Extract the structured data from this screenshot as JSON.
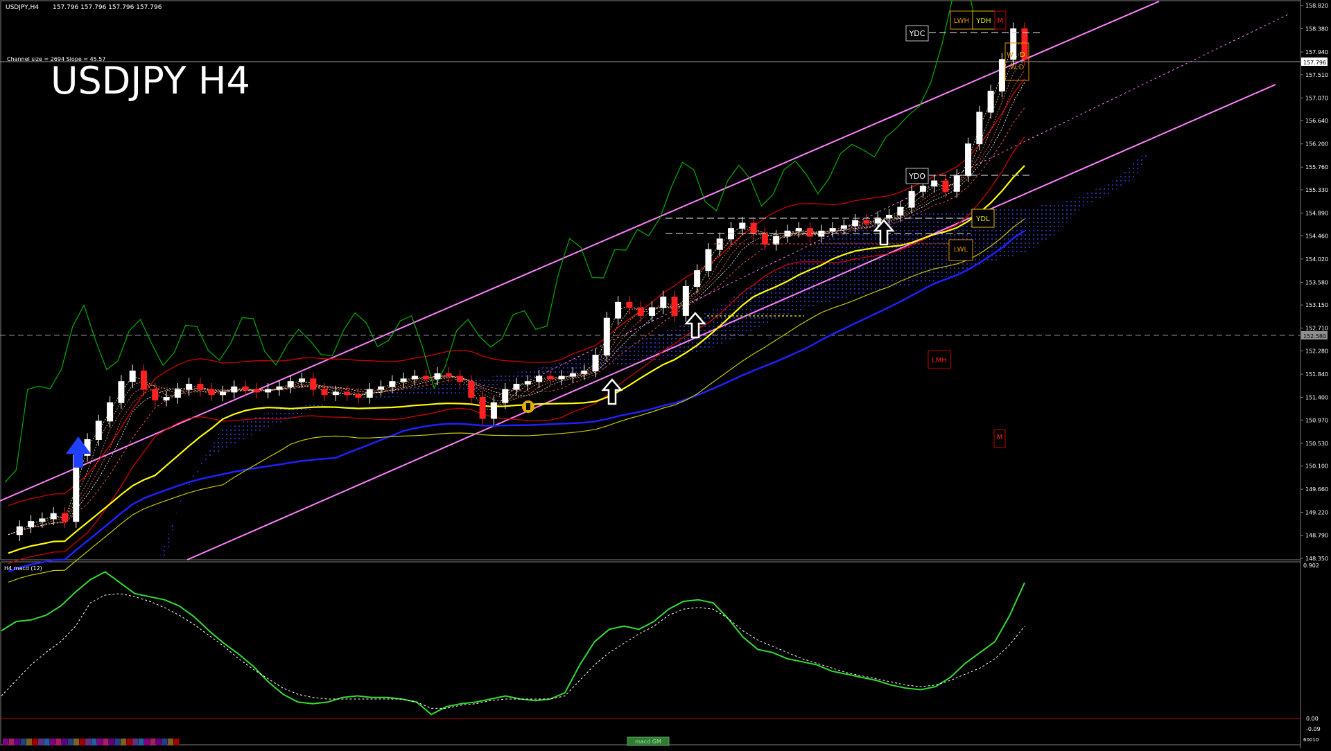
{
  "header": {
    "symbol_info": "USDJPY,H4",
    "ohlc": "157.796 157.796 157.796 157.796",
    "channel_info": "Channel size = 2694 Slope = 45.57",
    "big_title": "USDJPY H4"
  },
  "price_axis": {
    "labels": [
      "158.820",
      "158.380",
      "157.940",
      "157.510",
      "157.070",
      "156.640",
      "156.200",
      "155.760",
      "155.330",
      "154.890",
      "154.460",
      "154.020",
      "153.580",
      "153.150",
      "152.710",
      "152.280",
      "151.840",
      "151.400",
      "150.970",
      "150.530",
      "150.100",
      "149.660",
      "149.220",
      "148.790",
      "148.350"
    ],
    "current_price": "157.796",
    "marker_price": "152.580"
  },
  "level_boxes": {
    "ydc": "YDC",
    "ydo": "YDO",
    "ydl": "YDL",
    "lwh": "LWH",
    "ydh": "YDH",
    "lwl": "LWL",
    "lmh": "LMH",
    "m1": "M",
    "m2": "M",
    "w": "W",
    "d": "D",
    "wd": "W D"
  },
  "macd": {
    "title": "H4  macd (12)",
    "axis_labels": [
      "0.902",
      "0.00",
      "-0.09"
    ],
    "bottom_label": "macd GM",
    "corner_label": "60010"
  },
  "colors": {
    "background": "#000000",
    "channel": "#ff80ff",
    "ma_blue": "#2020ff",
    "ma_yellow": "#ffff00",
    "bollinger": "#d00000",
    "ichimoku_span": "#c8c800",
    "chikou": "#00b000",
    "macd_main": "#33dd33",
    "macd_signal": "#ffffff",
    "bull_candle": "#ffffff",
    "bear_candle": "#ff2020"
  },
  "chart_data": {
    "type": "line",
    "title": "USDJPY H4",
    "ylim": [
      148.35,
      158.82
    ],
    "x_label_count": 0,
    "series": [
      {
        "name": "USDJPY,H4",
        "values": [
          148.8,
          148.95,
          149.05,
          149.1,
          149.2,
          149.05,
          150.3,
          150.6,
          150.95,
          151.3,
          151.7,
          151.9,
          151.55,
          151.35,
          151.4,
          151.55,
          151.65,
          151.55,
          151.45,
          151.5,
          151.6,
          151.55,
          151.5,
          151.55,
          151.6,
          151.7,
          151.75,
          151.55,
          151.45,
          151.5,
          151.45,
          151.4,
          151.55,
          151.6,
          151.7,
          151.75,
          151.8,
          151.75,
          151.85,
          151.8,
          151.7,
          151.4,
          151.0,
          151.3,
          151.55,
          151.65,
          151.7,
          151.8,
          151.75,
          151.8,
          151.85,
          151.9,
          152.2,
          152.9,
          153.2,
          153.1,
          152.95,
          153.1,
          153.3,
          152.95,
          153.5,
          153.8,
          154.2,
          154.4,
          154.6,
          154.7,
          154.5,
          154.3,
          154.45,
          154.55,
          154.6,
          154.45,
          154.55,
          154.6,
          154.65,
          154.75,
          154.7,
          154.8,
          154.85,
          155.0,
          155.3,
          155.4,
          155.5,
          155.3,
          155.6,
          156.2,
          156.8,
          157.2,
          157.8,
          158.38,
          157.8
        ]
      }
    ],
    "macd": {
      "type": "line",
      "ylim": [
        -0.09,
        0.902
      ],
      "series": [
        {
          "name": "macd",
          "values": [
            0.52,
            0.58,
            0.59,
            0.62,
            0.68,
            0.77,
            0.85,
            0.9,
            0.83,
            0.76,
            0.74,
            0.72,
            0.68,
            0.61,
            0.52,
            0.44,
            0.37,
            0.29,
            0.19,
            0.11,
            0.06,
            0.05,
            0.06,
            0.09,
            0.1,
            0.09,
            0.09,
            0.08,
            0.06,
            -0.02,
            0.03,
            0.05,
            0.06,
            0.08,
            0.1,
            0.08,
            0.07,
            0.08,
            0.12,
            0.3,
            0.45,
            0.53,
            0.55,
            0.53,
            0.58,
            0.66,
            0.71,
            0.72,
            0.7,
            0.6,
            0.48,
            0.4,
            0.38,
            0.34,
            0.32,
            0.3,
            0.26,
            0.24,
            0.22,
            0.2,
            0.17,
            0.15,
            0.14,
            0.16,
            0.22,
            0.31,
            0.38,
            0.45,
            0.62,
            0.83
          ]
        },
        {
          "name": "signal",
          "values": [
            0.1,
            0.2,
            0.3,
            0.38,
            0.45,
            0.55,
            0.7,
            0.75,
            0.76,
            0.74,
            0.71,
            0.67,
            0.62,
            0.56,
            0.49,
            0.42,
            0.34,
            0.27,
            0.21,
            0.15,
            0.11,
            0.09,
            0.08,
            0.08,
            0.08,
            0.08,
            0.08,
            0.08,
            0.06,
            0.02,
            0.02,
            0.04,
            0.05,
            0.07,
            0.08,
            0.08,
            0.08,
            0.08,
            0.1,
            0.2,
            0.3,
            0.38,
            0.44,
            0.5,
            0.55,
            0.62,
            0.66,
            0.67,
            0.66,
            0.6,
            0.52,
            0.46,
            0.42,
            0.38,
            0.34,
            0.31,
            0.28,
            0.25,
            0.23,
            0.21,
            0.19,
            0.17,
            0.16,
            0.17,
            0.2,
            0.24,
            0.28,
            0.34,
            0.43,
            0.55
          ]
        }
      ]
    }
  }
}
